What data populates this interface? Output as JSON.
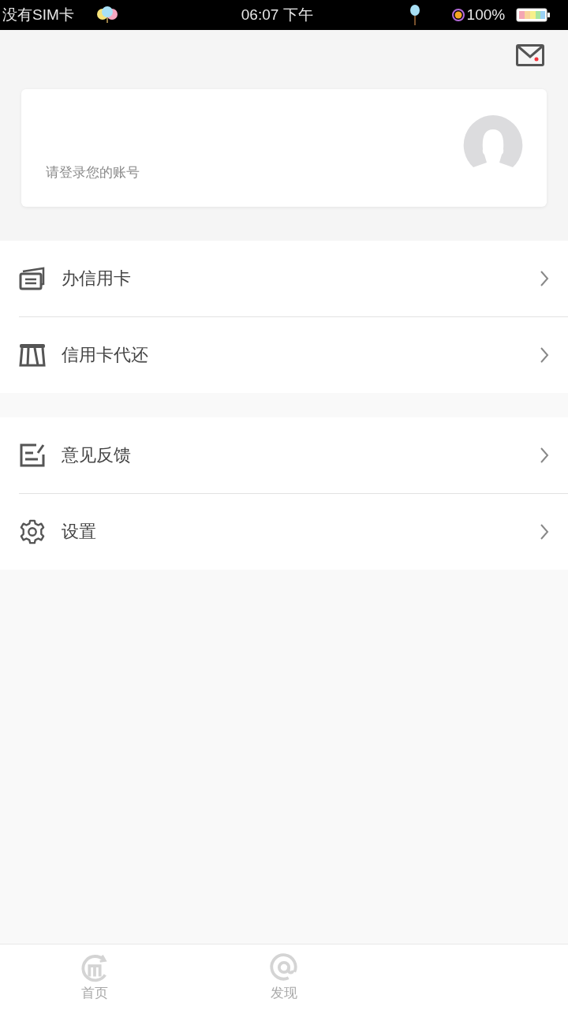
{
  "status_bar": {
    "carrier": "没有SIM卡",
    "time": "06:07 下午",
    "battery": "100%"
  },
  "header": {
    "mail_unread": true
  },
  "account_card": {
    "prompt": "请登录您的账号"
  },
  "menu_groups": [
    {
      "items": [
        {
          "kind": "card",
          "label": "办信用卡"
        },
        {
          "kind": "repay",
          "label": "信用卡代还"
        }
      ]
    },
    {
      "items": [
        {
          "kind": "feedback",
          "label": "意见反馈"
        },
        {
          "kind": "settings",
          "label": "设置"
        }
      ]
    }
  ],
  "tab_bar": [
    {
      "kind": "home",
      "label": "首页",
      "selected": false
    },
    {
      "kind": "discover",
      "label": "发现",
      "selected": false
    }
  ]
}
